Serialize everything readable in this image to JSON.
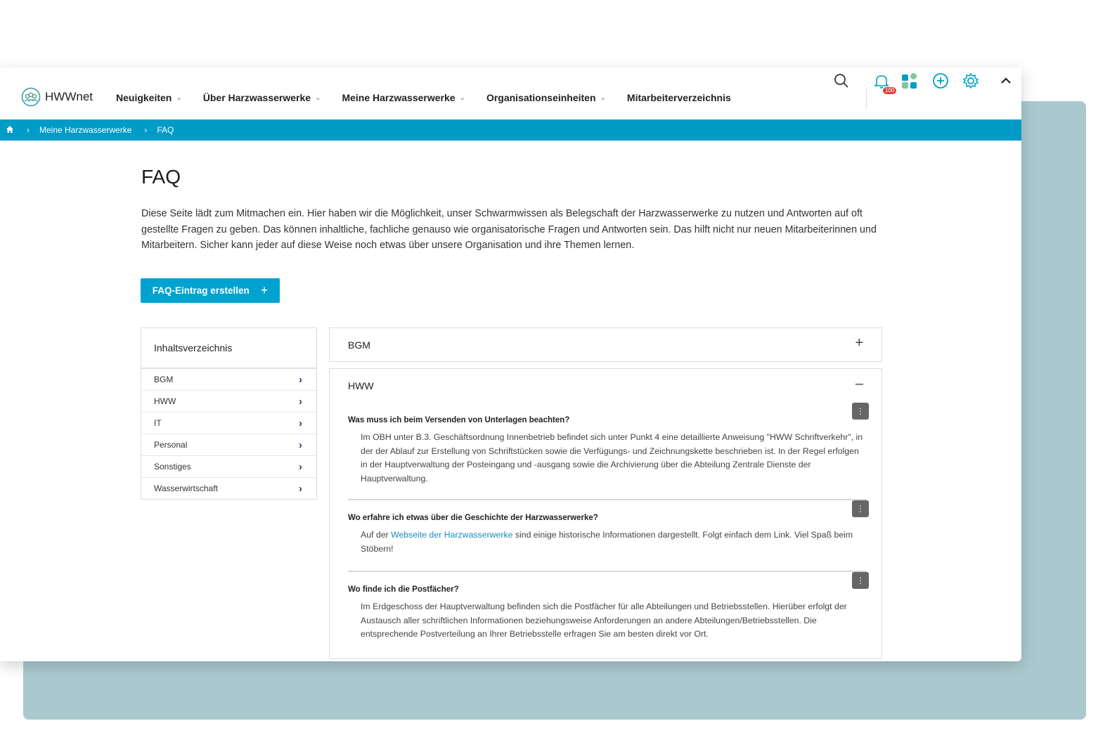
{
  "nav": {
    "logo_text": "HWWnet",
    "menu": [
      {
        "label": "Neuigkeiten"
      },
      {
        "label": "Über Harzwasserwerke"
      },
      {
        "label": "Meine Harzwasserwerke"
      },
      {
        "label": "Organisationseinheiten"
      },
      {
        "label": "Mitarbeiterverzeichnis"
      }
    ],
    "notification_count": "100",
    "icons": [
      "search-icon",
      "bell-icon",
      "apps-icon",
      "add-circle-icon",
      "gear-icon",
      "chevron-up-icon"
    ]
  },
  "breadcrumb": {
    "home_icon": "home-icon",
    "items": [
      "Meine Harzwasserwerke",
      "FAQ"
    ]
  },
  "page": {
    "title": "FAQ",
    "intro": "Diese Seite lädt zum Mitmachen ein. Hier haben wir die Möglichkeit, unser Schwarmwissen als Belegschaft der Harzwasserwerke zu nutzen und Antworten auf oft gestellte Fragen zu geben. Das können inhaltliche, fachliche genauso wie organisatorische Fragen und Antworten sein. Das hilft nicht nur neuen Mitarbeiterinnen und Mitarbeitern. Sicher kann jeder auf diese Weise noch etwas über unsere Organisation und ihre Themen lernen.",
    "create_button": "FAQ-Eintrag erstellen"
  },
  "toc": {
    "heading": "Inhaltsverzeichnis",
    "items": [
      "BGM",
      "HWW",
      "IT",
      "Personal",
      "Sonstiges",
      "Wasserwirtschaft"
    ]
  },
  "accordion": {
    "bgm": {
      "title": "BGM",
      "toggle": "+"
    },
    "hww": {
      "title": "HWW",
      "toggle": "–",
      "questions": [
        {
          "q": "Was muss ich beim Versenden von Unterlagen beachten?",
          "a": "Im OBH unter B.3. Geschäftsordnung Innenbetrieb befindet sich unter Punkt 4 eine detaillierte Anweisung \"HWW Schriftverkehr\", in der der Ablauf zur Erstellung von Schriftstücken sowie die Verfügungs- und Zeichnungskette beschrieben ist. In der Regel erfolgen in der Hauptverwaltung der Posteingang und -ausgang sowie die Archivierung über die Abteilung Zentrale Dienste der Hauptverwaltung."
        },
        {
          "q": "Wo erfahre ich etwas über die Geschichte der Harzwasserwerke?",
          "a_before": "Auf der ",
          "a_link": "Webseite der Harzwasserwerke",
          "a_after": " sind einige historische Informationen dargestellt. Folgt einfach dem Link. Viel Spaß beim Stöbern!"
        },
        {
          "q": "Wo finde ich die Postfächer?",
          "a": "Im Erdgeschoss der Hauptverwaltung befinden sich die Postfächer für alle Abteilungen und Betriebsstellen. Hierüber erfolgt der Austausch aller schriftlichen Informationen beziehungsweise Anforderungen an andere Abteilungen/Betriebsstellen. Die entsprechende Postverteilung an Ihrer Betriebsstelle erfragen Sie am besten direkt vor Ort."
        }
      ]
    }
  },
  "colors": {
    "accent": "#009cc8",
    "button": "#00a2d2",
    "background_card": "#aac9cf",
    "badge": "#e2423d"
  }
}
